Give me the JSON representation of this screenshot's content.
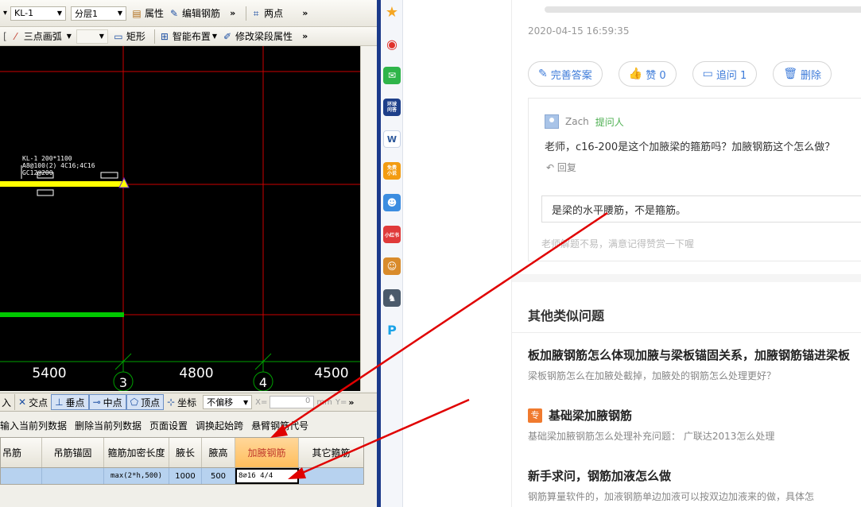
{
  "cad": {
    "toolbar1": {
      "element_combo": "KL-1",
      "layer_combo": "分层1",
      "properties": "属性",
      "edit_rebar": "编辑钢筋",
      "two_points": "两点"
    },
    "toolbar2": {
      "three_point_arc": "三点画弧",
      "rectangle": "矩形",
      "smart_layout": "智能布置",
      "modify_beam_segment": "修改梁段属性"
    },
    "canvas": {
      "beam_label_line1": "KL-1 200*1100",
      "beam_label_line2": "A8@100(2) 4C16;4C16",
      "beam_label_line3": "GC12@200",
      "dim_left": "5400",
      "dim_mid": "4800",
      "dim_right": "4500",
      "axis_3": "3",
      "axis_4": "4"
    },
    "snapbar": {
      "input": "入",
      "intersection": "交点",
      "perpendicular": "垂点",
      "midpoint": "中点",
      "vertex": "顶点",
      "coordinate": "坐标",
      "offset_combo": "不偏移",
      "x_label": "X=",
      "x_value": "0",
      "unit": "mm",
      "y_label": "Y="
    },
    "grid_menu": [
      "输入当前列数据",
      "删除当前列数据",
      "页面设置",
      "调换起始跨",
      "悬臂钢筋代号"
    ],
    "table": {
      "headers": [
        "吊筋",
        "吊筋锚固",
        "箍筋加密长度",
        "腋长",
        "腋高",
        "加腋钢筋",
        "其它箍筋"
      ],
      "row": [
        "",
        "",
        "max(2*h,500)",
        "1000",
        "500",
        "8⌀16 4/4",
        ""
      ]
    }
  },
  "qq_icons": [
    "star-icon",
    "weibo-icon",
    "mail-icon",
    "huanqiu-icon",
    "word-icon",
    "game-icon",
    "app-icon",
    "xiaohongshu-icon",
    "game2-icon",
    "game3-icon",
    "pp-icon"
  ],
  "qq_labels": {
    "huanqiu": "环球\n问答",
    "free": "免费\n小说",
    "xhs": "小红书"
  },
  "page": {
    "date": "2020-04-15 16:59:35",
    "actions": {
      "complete_answer": "完善答案",
      "like": "赞 0",
      "follow_up": "追问  1",
      "delete": "删除"
    },
    "comment": {
      "user": "Zach",
      "role": "提问人",
      "text": "老师，c16-200是这个加腋梁的箍筋吗？加腋钢筋这个怎么做？",
      "reply": "回复",
      "answer": "是梁的水平腰筋，不是箍筋。",
      "tip": "老师解题不易，满意记得赞赏一下喔"
    },
    "similar": {
      "title": "其他类似问题",
      "items": [
        {
          "title": "板加腋钢筋怎么体现加腋与梁板锚固关系，加腋钢筋锚进梁板",
          "desc": "梁板钢筋怎么在加腋处截掉，加腋处的钢筋怎么处理更好？"
        },
        {
          "badge": "专",
          "title": "基础梁加腋钢筋",
          "desc": "基础梁加腋钢筋怎么处理补充问题： 广联达2013怎么处理"
        },
        {
          "title": "新手求问，钢筋加液怎么做",
          "desc": "钢筋算量软件的，加液钢筋单边加液可以按双边加液来的做，具体怎"
        }
      ]
    }
  },
  "colors": {
    "cad_bg": "#000000",
    "beam_yellow": "#ffff00",
    "beam_green": "#00c800",
    "grid_red": "#cc0000",
    "arrow_red": "#e00000",
    "link_blue": "#3d7bd9",
    "active_header": "#ffbe5c"
  }
}
